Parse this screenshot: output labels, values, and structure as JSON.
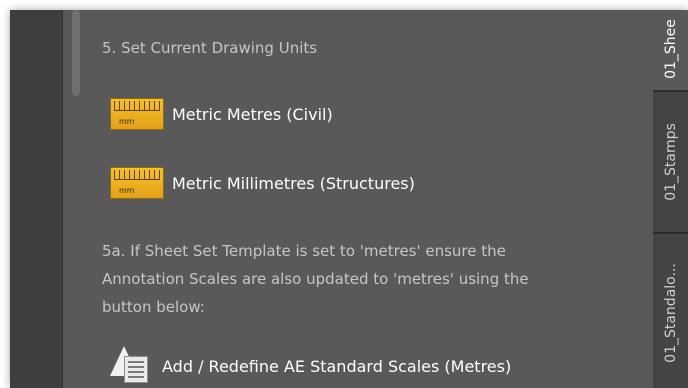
{
  "palette": {
    "panel_bg": "#595959",
    "sidebar_bg": "#3e3e3e",
    "heading_text": "#c6c6c6",
    "command_text": "#ffffff",
    "ruler_icon": "#f3b51f"
  },
  "panel": {
    "step_heading": "5. Set Current Drawing Units",
    "commands": [
      {
        "label": "Metric Metres (Civil)",
        "icon": "ruler-mm-icon",
        "icon_text": "mm"
      },
      {
        "label": "Metric Millimetres (Structures)",
        "icon": "ruler-mm-icon",
        "icon_text": "mm"
      }
    ],
    "info_lines": [
      "5a. If Sheet Set Template is set to 'metres' ensure the",
      "Annotation Scales are also updated to 'metres' using the",
      "button below:"
    ],
    "scale_command": {
      "label": "Add / Redefine AE Standard Scales (Metres)",
      "icon": "annotation-scale-icon"
    }
  },
  "tabs": [
    {
      "label": "01_Shee",
      "active": true
    },
    {
      "label": "01_Stamps",
      "active": false
    },
    {
      "label": "01_Standalo...",
      "active": false
    }
  ]
}
